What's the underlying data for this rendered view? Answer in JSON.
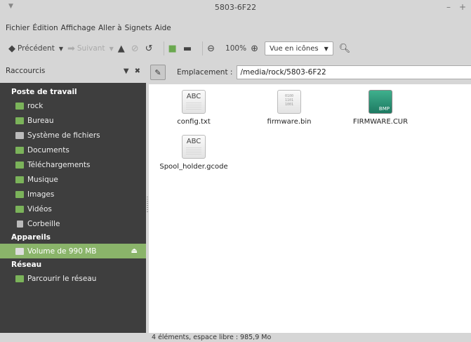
{
  "window": {
    "title": "5803-6F22",
    "minimize": "–",
    "maximize": "+"
  },
  "menu": [
    "Fichier",
    "Édition",
    "Affichage",
    "Aller à",
    "Signets",
    "Aide"
  ],
  "toolbar": {
    "back_label": "Précédent",
    "forward_label": "Suivant",
    "zoom_level": "100%",
    "view_mode": "Vue en icônes"
  },
  "sidebar": {
    "header_label": "Raccourcis",
    "sections": [
      {
        "title": "Poste de travail",
        "items": [
          {
            "label": "rock",
            "icon": "home-icon",
            "color": "#7bb35a"
          },
          {
            "label": "Bureau",
            "icon": "desktop-icon",
            "color": "#7bb35a"
          },
          {
            "label": "Système de fichiers",
            "icon": "drive-icon",
            "color": "#bbbbbb"
          },
          {
            "label": "Documents",
            "icon": "folder-icon",
            "color": "#7bb35a"
          },
          {
            "label": "Téléchargements",
            "icon": "folder-icon",
            "color": "#7bb35a"
          },
          {
            "label": "Musique",
            "icon": "folder-icon",
            "color": "#7bb35a"
          },
          {
            "label": "Images",
            "icon": "folder-icon",
            "color": "#7bb35a"
          },
          {
            "label": "Vidéos",
            "icon": "folder-icon",
            "color": "#7bb35a"
          },
          {
            "label": "Corbeille",
            "icon": "trash-icon",
            "color": "#bbbbbb"
          }
        ]
      },
      {
        "title": "Appareils",
        "items": [
          {
            "label": "Volume de 990 MB",
            "icon": "drive-icon",
            "color": "#dddddd",
            "selected": true
          }
        ]
      },
      {
        "title": "Réseau",
        "items": [
          {
            "label": "Parcourir le réseau",
            "icon": "network-icon",
            "color": "#7bb35a"
          }
        ]
      }
    ]
  },
  "location": {
    "label": "Emplacement :",
    "path": "/media/rock/5803-6F22"
  },
  "files": [
    {
      "name": "config.txt",
      "type": "text"
    },
    {
      "name": "firmware.bin",
      "type": "binary"
    },
    {
      "name": "FIRMWARE.CUR",
      "type": "bmp"
    },
    {
      "name": "Spool_holder.gcode",
      "type": "text"
    }
  ],
  "icon_text": {
    "abc": "ABC",
    "binary": "0100\n1101\n1001",
    "bmp": "BMP"
  },
  "status": "4 éléments, espace libre : 985,9 Mo"
}
